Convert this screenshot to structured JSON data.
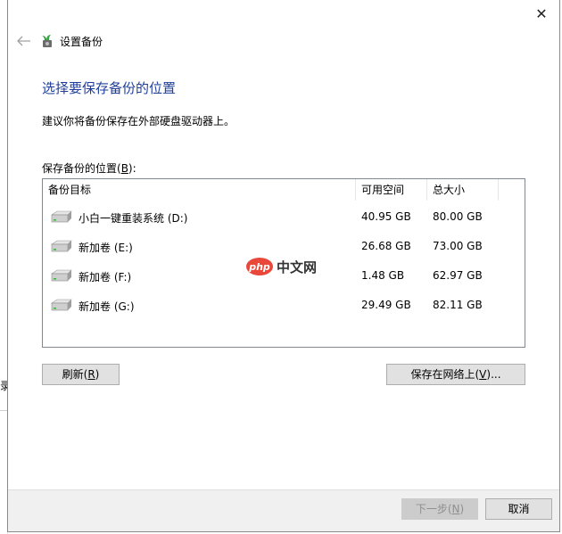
{
  "window": {
    "app_title": "设置备份",
    "close_glyph": "✕"
  },
  "page": {
    "heading": "选择要保存备份的位置",
    "subtitle": "建议你将备份保存在外部硬盘驱动器上。",
    "list_label_prefix": "保存备份的位置(",
    "list_label_key": "B",
    "list_label_suffix": "):"
  },
  "table": {
    "headers": [
      "备份目标",
      "可用空间",
      "总大小"
    ],
    "rows": [
      {
        "name": "小白一键重装系统 (D:)",
        "free": "40.95 GB",
        "total": "80.00 GB"
      },
      {
        "name": "新加卷 (E:)",
        "free": "26.68 GB",
        "total": "73.00 GB"
      },
      {
        "name": "新加卷 (F:)",
        "free": "1.48 GB",
        "total": "62.97 GB"
      },
      {
        "name": "新加卷 (G:)",
        "free": "29.49 GB",
        "total": "82.11 GB"
      }
    ]
  },
  "watermark": {
    "badge": "php",
    "text": "中文网"
  },
  "buttons": {
    "refresh_prefix": "刷新(",
    "refresh_key": "R",
    "refresh_suffix": ")",
    "network_prefix": "保存在网络上(",
    "network_key": "V",
    "network_suffix": ")...",
    "next_prefix": "下一步(",
    "next_key": "N",
    "next_suffix": ")",
    "cancel": "取消"
  },
  "background": {
    "edge_text": "录"
  },
  "icons": {
    "back": "back-arrow-icon",
    "app": "backup-app-icon",
    "drive": "hard-drive-icon",
    "close": "close-icon"
  }
}
